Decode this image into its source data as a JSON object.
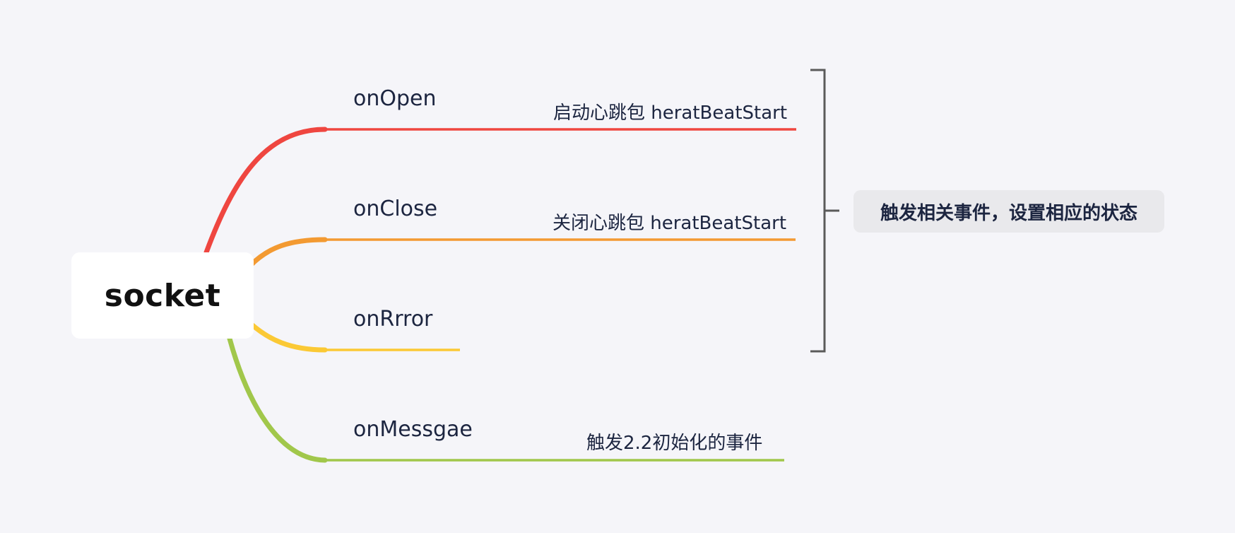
{
  "root": {
    "label": "socket"
  },
  "branches": [
    {
      "label": "onOpen",
      "note": "启动心跳包 heratBeatStart",
      "color": "#ef4640"
    },
    {
      "label": "onClose",
      "note": "关闭心跳包 heratBeatStart",
      "color": "#f39a32"
    },
    {
      "label": "onRrror",
      "note": "",
      "color": "#fbc935"
    },
    {
      "label": "onMessgae",
      "note": "触发2.2初始化的事件",
      "color": "#a1c74b"
    }
  ],
  "summary": {
    "label": "触发相关事件，设置相应的状态",
    "bracket_color": "#5a5a5a"
  }
}
